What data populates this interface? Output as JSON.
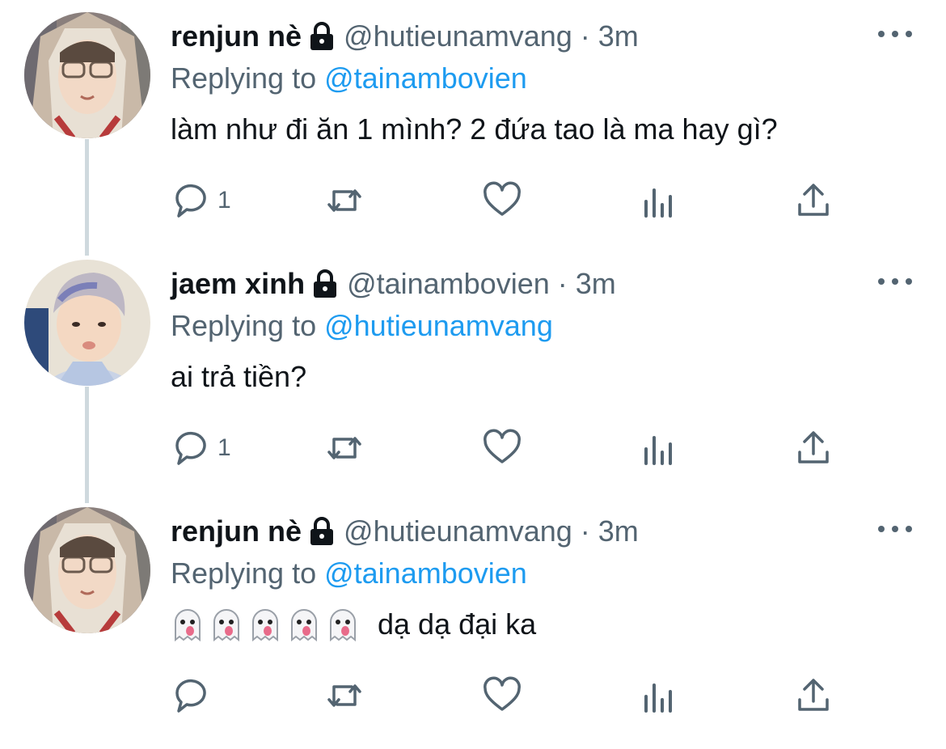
{
  "tweets": [
    {
      "name": "renjun nè",
      "handle": "@hutieunamvang",
      "time": "3m",
      "replying_label": "Replying to",
      "replying_to": "@tainambovien",
      "text": "làm như đi ăn 1 mình? 2 đứa tao là ma hay gì?",
      "reply_count": "1"
    },
    {
      "name": "jaem xinh",
      "handle": "@tainambovien",
      "time": "3m",
      "replying_label": "Replying to",
      "replying_to": "@hutieunamvang",
      "text": "ai trả tiền?",
      "reply_count": "1"
    },
    {
      "name": "renjun nè",
      "handle": "@hutieunamvang",
      "time": "3m",
      "replying_label": "Replying to",
      "replying_to": "@tainambovien",
      "text": "dạ dạ đại ka",
      "reply_count": ""
    }
  ],
  "separator": "·",
  "colors": {
    "name": "#0f1419",
    "secondary": "#536471",
    "mention": "#1d9bf0",
    "thread_line": "#cfd9de"
  },
  "icons": [
    "lock-icon",
    "more-icon",
    "reply-icon",
    "retweet-icon",
    "like-icon",
    "analytics-icon",
    "share-icon",
    "ghost-emoji"
  ]
}
